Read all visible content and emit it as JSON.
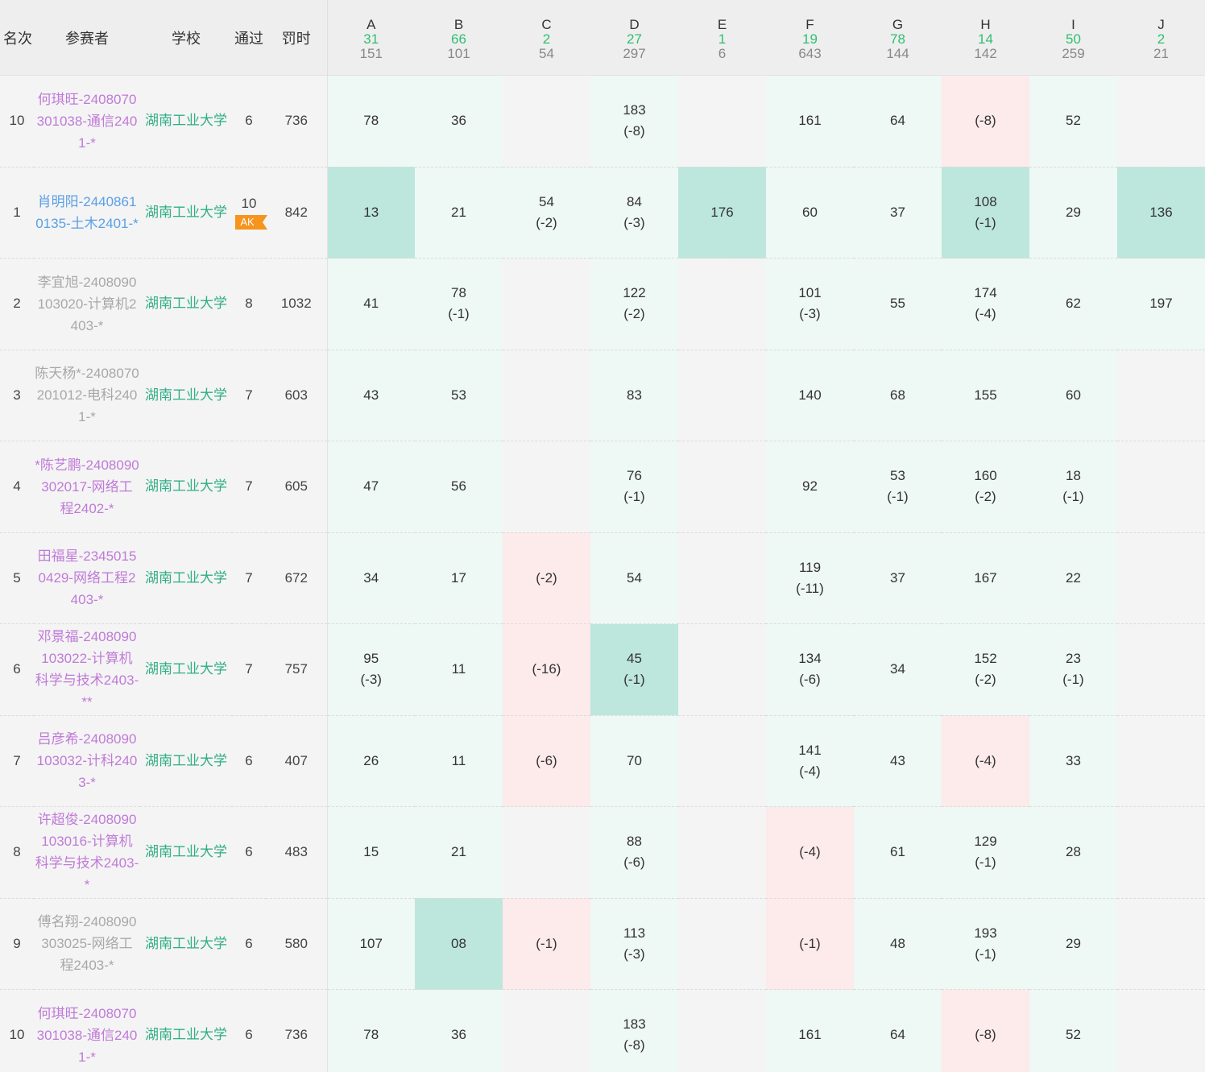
{
  "header": {
    "rank": "名次",
    "participant": "参赛者",
    "school": "学校",
    "solved": "通过",
    "penalty": "罚时"
  },
  "problems": [
    {
      "label": "A",
      "accepted": "31",
      "submitted": "151"
    },
    {
      "label": "B",
      "accepted": "66",
      "submitted": "101"
    },
    {
      "label": "C",
      "accepted": "2",
      "submitted": "54"
    },
    {
      "label": "D",
      "accepted": "27",
      "submitted": "297"
    },
    {
      "label": "E",
      "accepted": "1",
      "submitted": "6"
    },
    {
      "label": "F",
      "accepted": "19",
      "submitted": "643"
    },
    {
      "label": "G",
      "accepted": "78",
      "submitted": "144"
    },
    {
      "label": "H",
      "accepted": "14",
      "submitted": "142"
    },
    {
      "label": "I",
      "accepted": "50",
      "submitted": "259"
    },
    {
      "label": "J",
      "accepted": "2",
      "submitted": "21"
    }
  ],
  "colors": {
    "accepted_count": "#2fbf71",
    "school": "#2fae86",
    "first_blood": "#bde6dc",
    "solved": "#eef8f5",
    "failed": "#fdeaea",
    "ak_badge": "#f6941e"
  },
  "rows": [
    {
      "rank": "10",
      "name": "何琪旺-2408070301038-通信2401-*",
      "name_color": "purple",
      "school": "湖南工业大学",
      "solved": "6",
      "badge": "",
      "penalty": "736",
      "cells": [
        [
          "78",
          "",
          "ok"
        ],
        [
          "36",
          "",
          "ok"
        ],
        [
          "",
          "",
          "none"
        ],
        [
          "183",
          "(-8)",
          "ok"
        ],
        [
          "",
          "",
          "none"
        ],
        [
          "161",
          "",
          "ok"
        ],
        [
          "64",
          "",
          "ok"
        ],
        [
          "(-8)",
          "",
          "fail"
        ],
        [
          "52",
          "",
          "ok"
        ],
        [
          "",
          "",
          "none"
        ]
      ]
    },
    {
      "rank": "1",
      "name": "肖明阳-24408610135-土木2401-*",
      "name_color": "blue",
      "school": "湖南工业大学",
      "solved": "10",
      "badge": "AK",
      "penalty": "842",
      "cells": [
        [
          "13",
          "",
          "fb"
        ],
        [
          "21",
          "",
          "ok"
        ],
        [
          "54",
          "(-2)",
          "ok"
        ],
        [
          "84",
          "(-3)",
          "ok"
        ],
        [
          "176",
          "",
          "fb"
        ],
        [
          "60",
          "",
          "ok"
        ],
        [
          "37",
          "",
          "ok"
        ],
        [
          "108",
          "(-1)",
          "fb"
        ],
        [
          "29",
          "",
          "ok"
        ],
        [
          "136",
          "",
          "fb"
        ]
      ]
    },
    {
      "rank": "2",
      "name": "李宜旭-2408090103020-计算机2403-*",
      "name_color": "gray",
      "school": "湖南工业大学",
      "solved": "8",
      "badge": "",
      "penalty": "1032",
      "cells": [
        [
          "41",
          "",
          "ok"
        ],
        [
          "78",
          "(-1)",
          "ok"
        ],
        [
          "",
          "",
          "none"
        ],
        [
          "122",
          "(-2)",
          "ok"
        ],
        [
          "",
          "",
          "none"
        ],
        [
          "101",
          "(-3)",
          "ok"
        ],
        [
          "55",
          "",
          "ok"
        ],
        [
          "174",
          "(-4)",
          "ok"
        ],
        [
          "62",
          "",
          "ok"
        ],
        [
          "197",
          "",
          "ok"
        ]
      ]
    },
    {
      "rank": "3",
      "name": "陈天杨*-2408070201012-电科2401-*",
      "name_color": "gray",
      "school": "湖南工业大学",
      "solved": "7",
      "badge": "",
      "penalty": "603",
      "cells": [
        [
          "43",
          "",
          "ok"
        ],
        [
          "53",
          "",
          "ok"
        ],
        [
          "",
          "",
          "none"
        ],
        [
          "83",
          "",
          "ok"
        ],
        [
          "",
          "",
          "none"
        ],
        [
          "140",
          "",
          "ok"
        ],
        [
          "68",
          "",
          "ok"
        ],
        [
          "155",
          "",
          "ok"
        ],
        [
          "60",
          "",
          "ok"
        ],
        [
          "",
          "",
          "none"
        ]
      ]
    },
    {
      "rank": "4",
      "name": "*陈艺鹏-2408090302017-网络工程2402-*",
      "name_color": "purple",
      "school": "湖南工业大学",
      "solved": "7",
      "badge": "",
      "penalty": "605",
      "cells": [
        [
          "47",
          "",
          "ok"
        ],
        [
          "56",
          "",
          "ok"
        ],
        [
          "",
          "",
          "none"
        ],
        [
          "76",
          "(-1)",
          "ok"
        ],
        [
          "",
          "",
          "none"
        ],
        [
          "92",
          "",
          "ok"
        ],
        [
          "53",
          "(-1)",
          "ok"
        ],
        [
          "160",
          "(-2)",
          "ok"
        ],
        [
          "18",
          "(-1)",
          "ok"
        ],
        [
          "",
          "",
          "none"
        ]
      ]
    },
    {
      "rank": "5",
      "name": "田福星-23450150429-网络工程2403-*",
      "name_color": "purple",
      "school": "湖南工业大学",
      "solved": "7",
      "badge": "",
      "penalty": "672",
      "cells": [
        [
          "34",
          "",
          "ok"
        ],
        [
          "17",
          "",
          "ok"
        ],
        [
          "(-2)",
          "",
          "fail"
        ],
        [
          "54",
          "",
          "ok"
        ],
        [
          "",
          "",
          "none"
        ],
        [
          "119",
          "(-11)",
          "ok"
        ],
        [
          "37",
          "",
          "ok"
        ],
        [
          "167",
          "",
          "ok"
        ],
        [
          "22",
          "",
          "ok"
        ],
        [
          "",
          "",
          "none"
        ]
      ]
    },
    {
      "rank": "6",
      "name": "邓景福-2408090103022-计算机科学与技术2403-**",
      "name_color": "purple",
      "school": "湖南工业大学",
      "solved": "7",
      "badge": "",
      "penalty": "757",
      "cells": [
        [
          "95",
          "(-3)",
          "ok"
        ],
        [
          "11",
          "",
          "ok"
        ],
        [
          "(-16)",
          "",
          "fail"
        ],
        [
          "45",
          "(-1)",
          "fb"
        ],
        [
          "",
          "",
          "none"
        ],
        [
          "134",
          "(-6)",
          "ok"
        ],
        [
          "34",
          "",
          "ok"
        ],
        [
          "152",
          "(-2)",
          "ok"
        ],
        [
          "23",
          "(-1)",
          "ok"
        ],
        [
          "",
          "",
          "none"
        ]
      ]
    },
    {
      "rank": "7",
      "name": "吕彦希-2408090103032-计科2403-*",
      "name_color": "purple",
      "school": "湖南工业大学",
      "solved": "6",
      "badge": "",
      "penalty": "407",
      "cells": [
        [
          "26",
          "",
          "ok"
        ],
        [
          "11",
          "",
          "ok"
        ],
        [
          "(-6)",
          "",
          "fail"
        ],
        [
          "70",
          "",
          "ok"
        ],
        [
          "",
          "",
          "none"
        ],
        [
          "141",
          "(-4)",
          "ok"
        ],
        [
          "43",
          "",
          "ok"
        ],
        [
          "(-4)",
          "",
          "fail"
        ],
        [
          "33",
          "",
          "ok"
        ],
        [
          "",
          "",
          "none"
        ]
      ]
    },
    {
      "rank": "8",
      "name": "许超俊-2408090103016-计算机科学与技术2403-*",
      "name_color": "purple",
      "school": "湖南工业大学",
      "solved": "6",
      "badge": "",
      "penalty": "483",
      "cells": [
        [
          "15",
          "",
          "ok"
        ],
        [
          "21",
          "",
          "ok"
        ],
        [
          "",
          "",
          "none"
        ],
        [
          "88",
          "(-6)",
          "ok"
        ],
        [
          "",
          "",
          "none"
        ],
        [
          "(-4)",
          "",
          "fail"
        ],
        [
          "61",
          "",
          "ok"
        ],
        [
          "129",
          "(-1)",
          "ok"
        ],
        [
          "28",
          "",
          "ok"
        ],
        [
          "",
          "",
          "none"
        ]
      ]
    },
    {
      "rank": "9",
      "name": "傅名翔-2408090303025-网络工程2403-*",
      "name_color": "gray",
      "school": "湖南工业大学",
      "solved": "6",
      "badge": "",
      "penalty": "580",
      "cells": [
        [
          "107",
          "",
          "ok"
        ],
        [
          "08",
          "",
          "fb"
        ],
        [
          "(-1)",
          "",
          "fail"
        ],
        [
          "113",
          "(-3)",
          "ok"
        ],
        [
          "",
          "",
          "none"
        ],
        [
          "(-1)",
          "",
          "fail"
        ],
        [
          "48",
          "",
          "ok"
        ],
        [
          "193",
          "(-1)",
          "ok"
        ],
        [
          "29",
          "",
          "ok"
        ],
        [
          "",
          "",
          "none"
        ]
      ]
    },
    {
      "rank": "10",
      "name": "何琪旺-2408070301038-通信2401-*",
      "name_color": "purple",
      "school": "湖南工业大学",
      "solved": "6",
      "badge": "",
      "penalty": "736",
      "cells": [
        [
          "78",
          "",
          "ok"
        ],
        [
          "36",
          "",
          "ok"
        ],
        [
          "",
          "",
          "none"
        ],
        [
          "183",
          "(-8)",
          "ok"
        ],
        [
          "",
          "",
          "none"
        ],
        [
          "161",
          "",
          "ok"
        ],
        [
          "64",
          "",
          "ok"
        ],
        [
          "(-8)",
          "",
          "fail"
        ],
        [
          "52",
          "",
          "ok"
        ],
        [
          "",
          "",
          "none"
        ]
      ]
    }
  ]
}
